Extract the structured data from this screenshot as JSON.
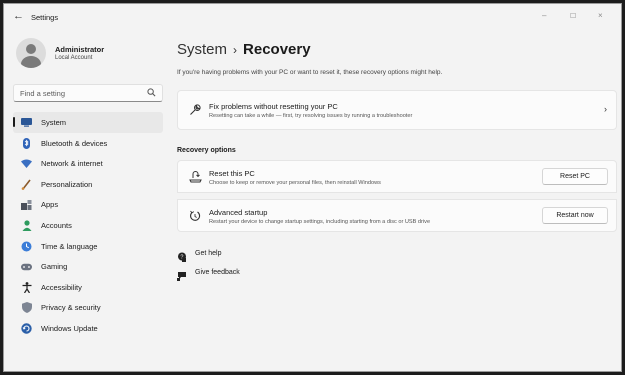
{
  "window": {
    "back_glyph": "←",
    "title": "Settings",
    "minimize": "–",
    "maximize": "☐",
    "close": "×"
  },
  "user": {
    "name": "Administrator",
    "account": "Local Account"
  },
  "search": {
    "placeholder": "Find a setting",
    "icon": "search-icon"
  },
  "nav": [
    {
      "label": "System",
      "icon": "system-icon",
      "active": true
    },
    {
      "label": "Bluetooth & devices",
      "icon": "bluetooth-icon",
      "active": false
    },
    {
      "label": "Network & internet",
      "icon": "wifi-icon",
      "active": false
    },
    {
      "label": "Personalization",
      "icon": "brush-icon",
      "active": false
    },
    {
      "label": "Apps",
      "icon": "apps-icon",
      "active": false
    },
    {
      "label": "Accounts",
      "icon": "person-icon",
      "active": false
    },
    {
      "label": "Time & language",
      "icon": "globe-clock-icon",
      "active": false
    },
    {
      "label": "Gaming",
      "icon": "gamepad-icon",
      "active": false
    },
    {
      "label": "Accessibility",
      "icon": "accessibility-icon",
      "active": false
    },
    {
      "label": "Privacy & security",
      "icon": "shield-icon",
      "active": false
    },
    {
      "label": "Windows Update",
      "icon": "update-icon",
      "active": false
    }
  ],
  "header": {
    "parent": "System",
    "separator": "›",
    "current": "Recovery",
    "intro": "If you're having problems with your PC or want to reset it, these recovery options might help."
  },
  "fix_card": {
    "title": "Fix problems without resetting your PC",
    "description": "Resetting can take a while — first, try resolving issues by running a troubleshooter",
    "chevron": "›",
    "icon": "wrench-icon"
  },
  "recovery_options": {
    "label": "Recovery options",
    "items": [
      {
        "title": "Reset this PC",
        "description": "Choose to keep or remove your personal files, then reinstall Windows",
        "button": "Reset PC",
        "icon": "reset-pc-icon"
      },
      {
        "title": "Advanced startup",
        "description": "Restart your device to change startup settings, including starting from a disc or USB drive",
        "button": "Restart now",
        "icon": "restart-icon"
      }
    ]
  },
  "links": [
    {
      "label": "Get help",
      "icon": "help-icon"
    },
    {
      "label": "Give feedback",
      "icon": "feedback-icon"
    }
  ],
  "colors": {
    "window_bg": "#f3f3f3",
    "card_bg": "#fbfbfb",
    "active_nav_bg": "#e8e8e8",
    "text": "#1b1b1b"
  }
}
